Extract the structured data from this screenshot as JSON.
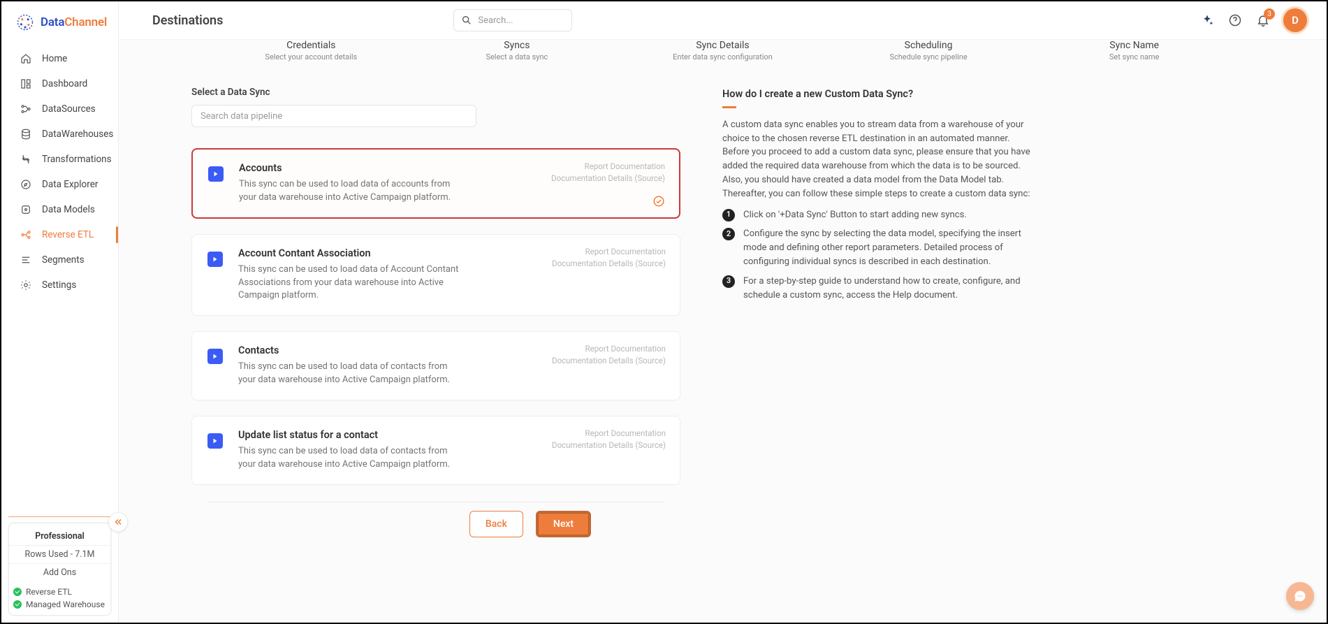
{
  "brand": {
    "part1": "Data",
    "part2": "Channel"
  },
  "sidebar": {
    "items": [
      {
        "label": "Home"
      },
      {
        "label": "Dashboard"
      },
      {
        "label": "DataSources"
      },
      {
        "label": "DataWarehouses"
      },
      {
        "label": "Transformations"
      },
      {
        "label": "Data Explorer"
      },
      {
        "label": "Data Models"
      },
      {
        "label": "Reverse ETL"
      },
      {
        "label": "Segments"
      },
      {
        "label": "Settings"
      }
    ],
    "plan": {
      "name": "Professional",
      "rows_used": "Rows Used - 7.1M",
      "addons_header": "Add Ons"
    },
    "addons": [
      {
        "label": "Reverse ETL"
      },
      {
        "label": "Managed Warehouse"
      }
    ]
  },
  "topbar": {
    "title": "Destinations",
    "search_placeholder": "Search...",
    "notification_count": "3",
    "avatar_initial": "D"
  },
  "wizard": [
    {
      "title": "Credentials",
      "sub": "Select your account details"
    },
    {
      "title": "Syncs",
      "sub": "Select a data sync"
    },
    {
      "title": "Sync Details",
      "sub": "Enter data sync configuration"
    },
    {
      "title": "Scheduling",
      "sub": "Schedule sync pipeline"
    },
    {
      "title": "Sync Name",
      "sub": "Set sync name"
    }
  ],
  "section": {
    "title": "Select a Data Sync",
    "search_placeholder": "Search data pipeline"
  },
  "syncs": [
    {
      "title": "Accounts",
      "desc": "This sync can be used to load data of accounts from your data warehouse into Active Campaign platform.",
      "selected": true
    },
    {
      "title": "Account Contant Association",
      "desc": "This sync can be used to load data of Account Contant Associations from your data warehouse into Active Campaign platform.",
      "selected": false
    },
    {
      "title": "Contacts",
      "desc": "This sync can be used to load data of contacts from your data warehouse into Active Campaign platform.",
      "selected": false
    },
    {
      "title": "Update list status for a contact",
      "desc": "This sync can be used to load data of contacts from your data warehouse into Active Campaign platform.",
      "selected": false
    }
  ],
  "card_links": {
    "l1": "Report Documentation",
    "l2": "Documentation Details (Source)"
  },
  "footer": {
    "back": "Back",
    "next": "Next"
  },
  "help": {
    "title": "How do I create a new Custom Data Sync?",
    "intro": "A custom data sync enables you to stream data from a warehouse of your choice to the chosen reverse ETL destination in an automated manner. Before you proceed to add a custom data sync, please ensure that you have added the required data warehouse from which the data is to be sourced. Also, you should have created a data model from the Data Model tab.",
    "intro2": "Thereafter, you can follow these simple steps to create a custom data sync:",
    "steps": [
      "Click on '+Data Sync' Button to start adding new syncs.",
      "Configure the sync by selecting the data model, specifying the insert mode and defining other report parameters. Detailed process of configuring individual syncs is described in each destination.",
      "For a step-by-step guide to understand how to create, configure, and schedule a custom sync, access the Help document."
    ]
  }
}
